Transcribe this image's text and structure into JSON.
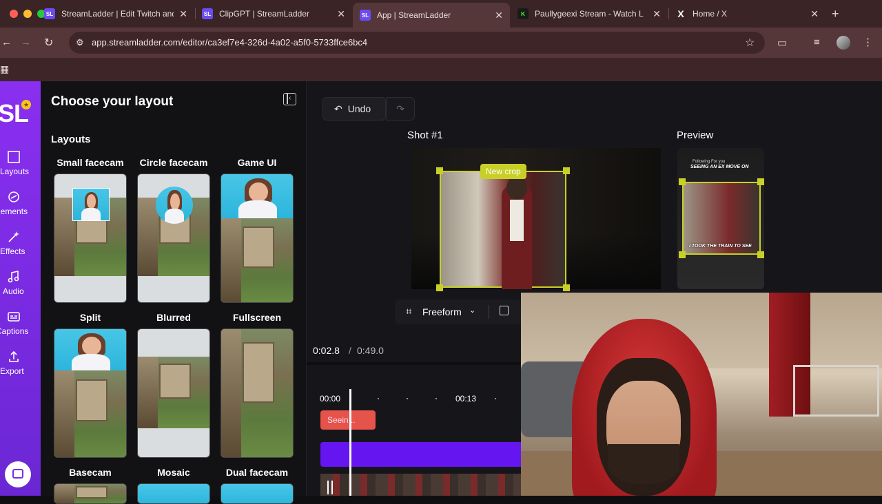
{
  "browser": {
    "tabs": [
      {
        "favicon": "SL",
        "favicon_color": "#6c4cf1",
        "title": "StreamLadder | Edit Twitch and"
      },
      {
        "favicon": "SL",
        "favicon_color": "#6c4cf1",
        "title": "ClipGPT | StreamLadder"
      },
      {
        "favicon": "SL",
        "favicon_color": "#6c4cf1",
        "title": "App | StreamLadder"
      },
      {
        "favicon": "K",
        "favicon_color": "#53fc18",
        "title": "Paullygeexi Stream - Watch L"
      },
      {
        "favicon": "X",
        "favicon_color": "#000000",
        "title": "Home / X"
      }
    ],
    "url": "app.streamladder.com/editor/ca3ef7e4-326d-4a02-a5f0-5733ffce6bc4"
  },
  "rail": {
    "logo": "SL",
    "items": [
      {
        "label": "Layouts",
        "icon": "layout-icon"
      },
      {
        "label": "Elements",
        "icon": "shapes-icon"
      },
      {
        "label": "Effects",
        "icon": "magic-wand-icon"
      },
      {
        "label": "Audio",
        "icon": "music-icon"
      },
      {
        "label": "Captions",
        "icon": "captions-icon"
      },
      {
        "label": "Export",
        "icon": "export-icon"
      }
    ]
  },
  "panel": {
    "title": "Choose your layout",
    "section": "Layouts",
    "layouts": [
      {
        "label": "Small facecam"
      },
      {
        "label": "Circle facecam"
      },
      {
        "label": "Game UI"
      },
      {
        "label": "Split"
      },
      {
        "label": "Blurred"
      },
      {
        "label": "Fullscreen"
      },
      {
        "label": "Basecam"
      },
      {
        "label": "Mosaic"
      },
      {
        "label": "Dual facecam"
      }
    ]
  },
  "editor": {
    "undo": "Undo",
    "shot_title": "Shot #1",
    "preview_title": "Preview",
    "crop_tag": "New crop",
    "preview_caption_top": "SEEING AN EX MOVE ON",
    "preview_caption_bottom": "I TOOK THE TRAIN TO SEE",
    "preview_header": "Following  For you",
    "freeform": "Freeform",
    "time_current": "0:02.8",
    "time_sep": "/",
    "time_total": "0:49.0",
    "ruler_start": "00:00",
    "ruler_mid": "00:13",
    "clip_label": "Seein..."
  },
  "colors": {
    "rail": "#7a2be8",
    "crop_accent": "#c8d027",
    "track_purple": "#6515f0",
    "clip_red": "#e5534b"
  }
}
